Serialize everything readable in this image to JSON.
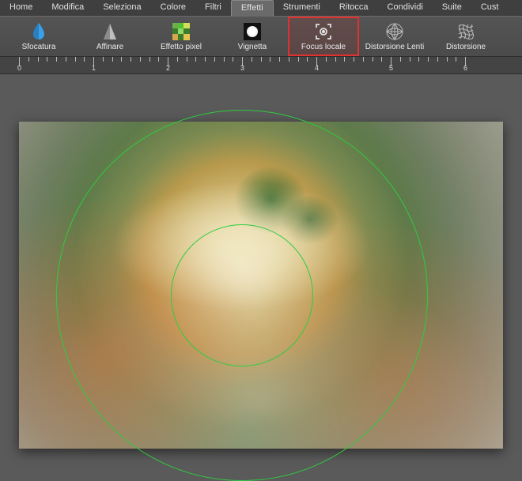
{
  "menu": {
    "items": [
      "Home",
      "Modifica",
      "Seleziona",
      "Colore",
      "Filtri",
      "Effetti",
      "Strumenti",
      "Ritocca",
      "Condividi",
      "Suite",
      "Cust"
    ],
    "active_index": 5
  },
  "toolbar": {
    "items": [
      {
        "label": "Sfocatura",
        "icon": "blur"
      },
      {
        "label": "Affinare",
        "icon": "sharpen"
      },
      {
        "label": "Effetto pixel",
        "icon": "pixelate"
      },
      {
        "label": "Vignetta",
        "icon": "vignette"
      },
      {
        "label": "Focus locale",
        "icon": "localfocus",
        "highlight": true
      },
      {
        "label": "Distorsione Lenti",
        "icon": "lens"
      },
      {
        "label": "Distorsione",
        "icon": "distort"
      }
    ]
  },
  "ruler": {
    "labels": [
      "0",
      "1",
      "2",
      "3",
      "4",
      "5",
      "6"
    ]
  }
}
